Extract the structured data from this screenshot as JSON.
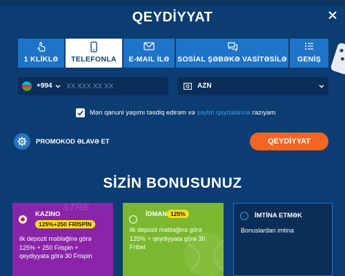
{
  "modal": {
    "title": "QEYDİYYAT"
  },
  "tabs": [
    {
      "label": "1 KLİKLƏ",
      "icon": "hand-pointer-icon"
    },
    {
      "label": "TELEFONLA",
      "icon": "smartphone-icon",
      "active": true
    },
    {
      "label": "E-MAIL İLƏ",
      "icon": "envelope-icon"
    },
    {
      "label": "SOSİAL ŞƏBƏKƏ VASİTƏSİLƏ",
      "icon": "chat-bubbles-icon"
    },
    {
      "label": "GENİŞ",
      "icon": "list-icon"
    }
  ],
  "phone": {
    "country_code": "+994",
    "placeholder": "XX XXX XX XX",
    "flag_colors": [
      "#00b5e2",
      "#ef3340",
      "#509e2f"
    ]
  },
  "currency": {
    "value": "AZN"
  },
  "agreement": {
    "prefix": "Mən qanuni yaşımı təsdiq edirəm və",
    "link": "saytın qaydalarına",
    "suffix": "razıyam"
  },
  "promo": {
    "label": "PROMOKOD ƏLAVƏ ET"
  },
  "submit": {
    "label": "QEYDİYYAT"
  },
  "bonus": {
    "title": "SİZİN BONUSUNUZ",
    "cards": [
      {
        "name": "KAZINO",
        "badge": "125%+250 FRİSPİN",
        "lines": [
          "ilk depozit məbləğinə görə",
          "125% + 250 Frispin +",
          "qeydiyyata görə 30 Frispin"
        ],
        "selected": true
      },
      {
        "name": "İDMAN",
        "badge": "125%",
        "lines": [
          "ilk depozit məbləğinə görə",
          "125% + qeydiyyata görə 30",
          "Fribet"
        ],
        "selected": false
      },
      {
        "name": "İMTİNA ETMƏK",
        "lines": [
          "Bonuslardan imtina"
        ],
        "selected": false
      }
    ]
  },
  "colors": {
    "background": "#0b3d74",
    "tab": "#1f74c8",
    "accent": "#f26522",
    "casino": "#8a24a8",
    "sport": "#7cb82f",
    "badge": "#f5df1e"
  }
}
